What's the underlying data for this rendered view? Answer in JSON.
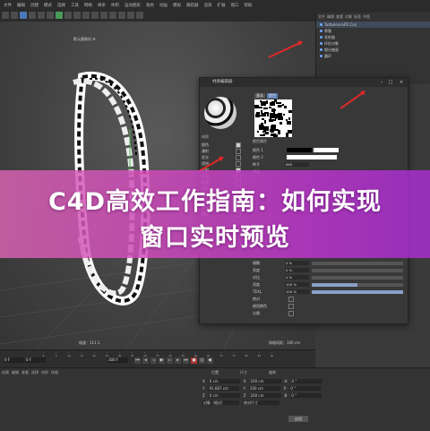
{
  "menu": [
    "文件",
    "编辑",
    "创建",
    "模式",
    "选择",
    "工具",
    "网格",
    "样条",
    "体积",
    "运动图形",
    "角色",
    "动画",
    "模拟",
    "跟踪器",
    "渲染",
    "扩展",
    "窗口",
    "帮助"
  ],
  "viewport": {
    "label": "默认摄像机 ✲"
  },
  "object_manager": {
    "menu": [
      "文件",
      "编辑",
      "查看",
      "对象",
      "标签",
      "书签"
    ],
    "rows": [
      {
        "label": "TurbulenceFD Con",
        "selected": true
      },
      {
        "label": "骨骼"
      },
      {
        "label": "发射器"
      },
      {
        "label": "环形对象"
      },
      {
        "label": "细分曲面"
      },
      {
        "label": "圆环"
      }
    ]
  },
  "dialog": {
    "title": "材质编辑器",
    "tabs": [
      "基本",
      "颜色"
    ],
    "section": "颜色属性",
    "search_label": "材质",
    "channels_title": "颜色",
    "channels": [
      {
        "label": "颜色",
        "checked": true
      },
      {
        "label": "漫射",
        "checked": false
      },
      {
        "label": "发光",
        "checked": false
      },
      {
        "label": "透明",
        "checked": false
      },
      {
        "label": "反射",
        "checked": true
      },
      {
        "label": "环境",
        "checked": false
      },
      {
        "label": "烟雾",
        "checked": false
      },
      {
        "label": "凹凸",
        "checked": false
      },
      {
        "label": "法线",
        "checked": false
      },
      {
        "label": "Alpha",
        "checked": false
      },
      {
        "label": "辉光",
        "checked": false
      },
      {
        "label": "置换",
        "checked": false
      }
    ],
    "props": {
      "color1": "颜色 1",
      "color2": "颜色 2",
      "seed": "种子",
      "seed_val": "665",
      "noise": "噪波",
      "blur_label": "模糊",
      "blur_val": "0 %",
      "brightness": "亮度",
      "brightness_val": "0 %",
      "contrast": "对比",
      "contrast_val": "0 %",
      "alpha_label": "亮度",
      "alpha_val": "100 %",
      "texel": "TEXL",
      "texel_val": "100 %",
      "abs": "绝对",
      "opt1": "使用颜色",
      "opt2": "分隔"
    }
  },
  "timeline": {
    "ticks": [
      "0",
      "5",
      "10",
      "15",
      "20",
      "25",
      "30",
      "35",
      "40",
      "45",
      "50",
      "55",
      "60",
      "65",
      "70",
      "75",
      "80",
      "85",
      "90"
    ],
    "frame_start": "0 F",
    "frame_end": "300 F",
    "frame_cur": "0 F",
    "status": "帧速：111.1",
    "status_right": "网格间距：100 cm"
  },
  "coords": {
    "headers": [
      "位置",
      "尺寸",
      "旋转"
    ],
    "rows": [
      {
        "axis": "X",
        "pos": "0 cm",
        "size": "200 cm",
        "rot_label": "H",
        "rot": "0 °"
      },
      {
        "axis": "Y",
        "pos": "91.687 cm",
        "size": "200 cm",
        "rot_label": "P",
        "rot": "0 °"
      },
      {
        "axis": "Z",
        "pos": "0 cm",
        "size": "200 cm",
        "rot_label": "B",
        "rot": "0 °"
      }
    ],
    "mode1": "对象（相对）",
    "mode2": "绝对尺寸",
    "apply": "应用"
  },
  "material_manager": {
    "menu": [
      "创建",
      "编辑",
      "查看",
      "选择",
      "材质",
      "纹理"
    ]
  },
  "banner": {
    "line1": "C4D高效工作指南：如何实现",
    "line2": "窗口实时预览"
  },
  "colors": {
    "banner": "#c84fc0",
    "accent_arrow": "#e02828",
    "selection": "#5b7db5"
  }
}
